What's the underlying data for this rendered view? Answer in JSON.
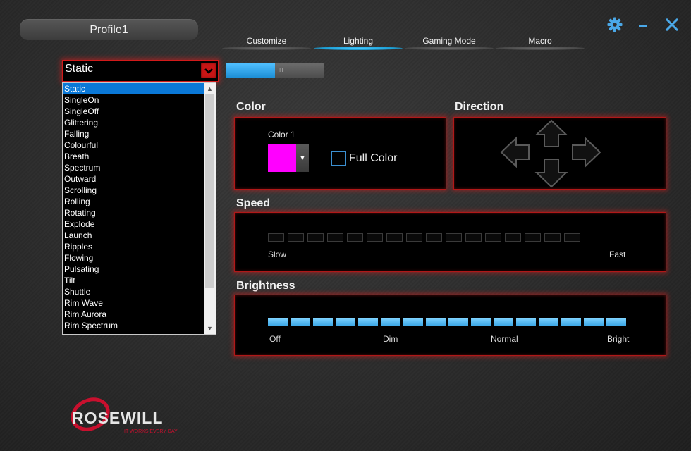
{
  "profile": {
    "name": "Profile1"
  },
  "window_controls": {
    "settings_icon": "gear-icon",
    "minimize_icon": "minimize-icon",
    "close_icon": "close-icon",
    "accent": "#4aa8e8"
  },
  "tabs": [
    {
      "label": "Customize",
      "active": false
    },
    {
      "label": "Lighting",
      "active": true
    },
    {
      "label": "Gaming Mode",
      "active": false
    },
    {
      "label": "Macro",
      "active": false
    }
  ],
  "lighting_mode": {
    "selected": "Static",
    "options": [
      "Static",
      "SingleOn",
      "SingleOff",
      "Glittering",
      "Falling",
      "Colourful",
      "Breath",
      "Spectrum",
      "Outward",
      "Scrolling",
      "Rolling",
      "Rotating",
      "Explode",
      "Launch",
      "Ripples",
      "Flowing",
      "Pulsating",
      "Tilt",
      "Shuttle",
      "Rim Wave",
      "Rim Aurora",
      "Rim Spectrum"
    ]
  },
  "toggle": {
    "fill_fraction": 0.5,
    "grip": "II"
  },
  "color_section": {
    "heading": "Color",
    "color1_label": "Color 1",
    "color1_value": "#ff00ff",
    "full_color_label": "Full Color",
    "full_color_checked": false
  },
  "direction_section": {
    "heading": "Direction"
  },
  "speed_section": {
    "heading": "Speed",
    "slow_label": "Slow",
    "fast_label": "Fast",
    "segments": 16,
    "level": 0
  },
  "brightness_section": {
    "heading": "Brightness",
    "labels": [
      "Off",
      "Dim",
      "Normal",
      "Bright"
    ],
    "segments": 16,
    "level": 16
  },
  "logo": {
    "text": "ROSEWILL",
    "tagline": "IT WORKS EVERY DAY",
    "brand_color": "#c8102e"
  },
  "colors": {
    "panel_border": "#b01818",
    "selection": "#0a78d7",
    "active_tab": "#1da1d8"
  }
}
